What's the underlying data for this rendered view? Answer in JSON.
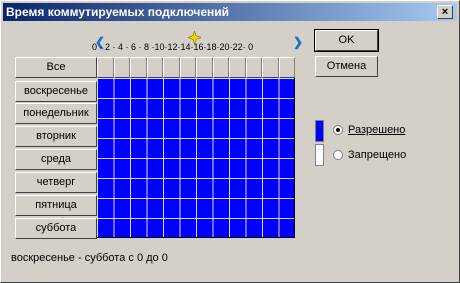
{
  "window": {
    "title": "Время коммутируемых подключений",
    "close_label": "×"
  },
  "buttons": {
    "ok": "OK",
    "cancel": "Отмена"
  },
  "hours": {
    "labels": "0 · 2 · 4 · 6 · 8 ·10·12·14·16·18·20·22· 0"
  },
  "days": {
    "all": "Все",
    "list": [
      "воскресенье",
      "понедельник",
      "вторник",
      "среда",
      "четверг",
      "пятница",
      "суббота"
    ]
  },
  "legend": {
    "allowed_label": "Разрешено",
    "denied_label": "Запрещено",
    "allowed_color": "#0000ff",
    "denied_color": "#ffffff",
    "selected": "allowed"
  },
  "status_text": "воскресенье - суббота с 0 до 0",
  "icons": {
    "left_arrow": "chevron-left-icon",
    "right_arrow": "chevron-right-icon",
    "sun": "sun-icon"
  }
}
